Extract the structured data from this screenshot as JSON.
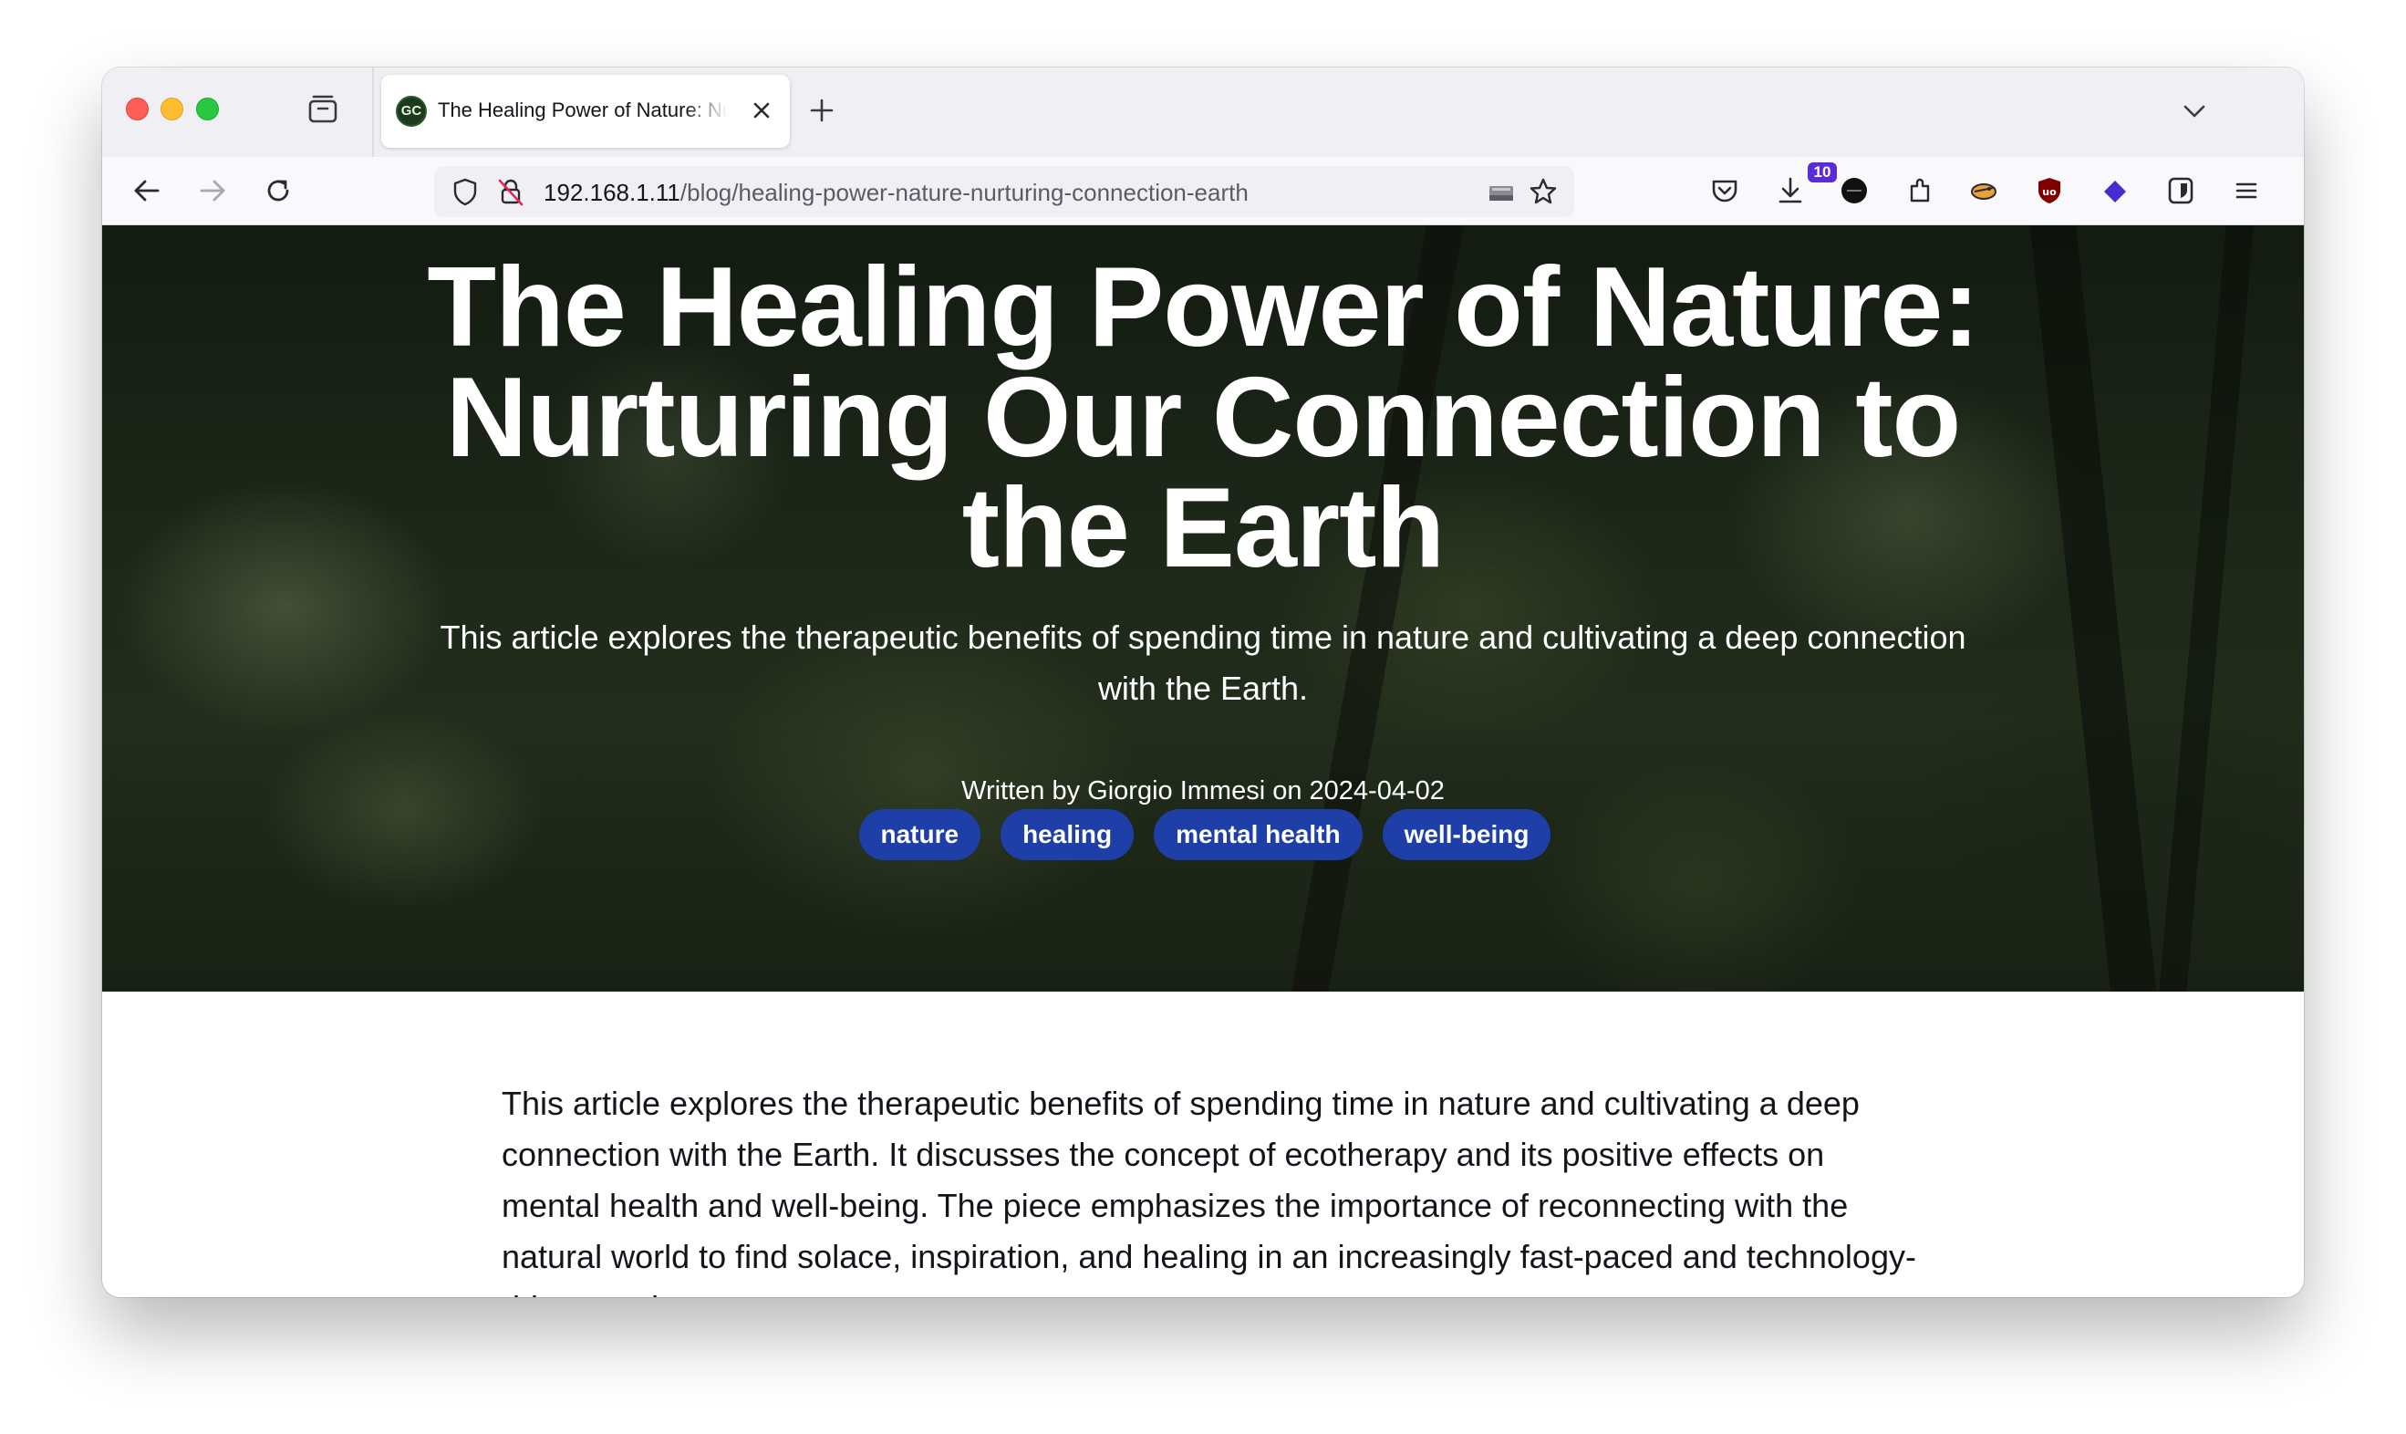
{
  "browser": {
    "tab": {
      "title": "The Healing Power of Nature: Nurturing Our Connection to the Earth",
      "favicon_text": "GC"
    },
    "address_bar": {
      "host": "192.168.1.11",
      "path": "/blog/healing-power-nature-nurturing-connection-earth"
    },
    "toolbar": {
      "extension_badge": "10"
    },
    "icons": [
      "tab-overview-icon",
      "close-icon",
      "plus-icon",
      "chevron-down-icon",
      "back-arrow-icon",
      "forward-arrow-icon",
      "reload-icon",
      "shield-icon",
      "insecure-lock-icon",
      "drive-icon",
      "star-icon",
      "pocket-icon",
      "download-icon",
      "extensions-icon",
      "ublock-icon",
      "bitwarden-icon",
      "menu-icon"
    ]
  },
  "hero": {
    "title": "The Healing Power of Nature: Nurturing Our Connection to the Earth",
    "subtitle": "This article explores the therapeutic benefits of spending time in nature and cultivating a deep connection with the Earth.",
    "byline": "Written by Giorgio Immesi on 2024-04-02",
    "tags": [
      "nature",
      "healing",
      "mental health",
      "well-being"
    ]
  },
  "article": {
    "intro": "This article explores the therapeutic benefits of spending time in nature and cultivating a deep connection with the Earth. It discusses the concept of ecotherapy and its positive effects on mental health and well-being. The piece emphasizes the importance of reconnecting with the natural world to find solace, inspiration, and healing in an increasingly fast-paced and technology-driven society."
  },
  "colors": {
    "tag_background": "#1e3fa8",
    "hero_overlay": "#000000",
    "tab_strip": "#f0f0f4"
  }
}
